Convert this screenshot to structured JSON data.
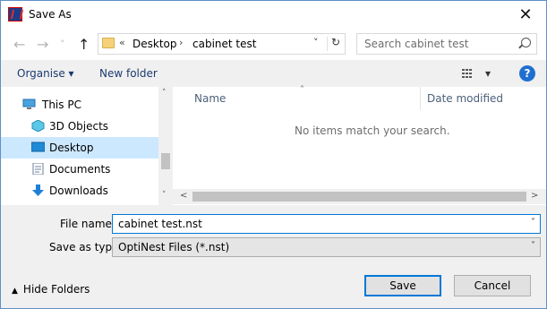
{
  "window": {
    "title": "Save As",
    "close_glyph": "✕",
    "app_icon": "optinest-app-icon"
  },
  "nav": {
    "back_glyph": "←",
    "forward_glyph": "→",
    "recent_glyph": "˅",
    "up_glyph": "↑",
    "breadcrumb": {
      "overflow": "«",
      "items": [
        "Desktop",
        "cabinet test"
      ],
      "separator": "›"
    },
    "dropdown_glyph": "˅",
    "refresh_glyph": "↻",
    "search_placeholder": "Search cabinet test"
  },
  "toolbar": {
    "organise_label": "Organise",
    "organise_caret": "▾",
    "new_folder_label": "New folder",
    "view_caret": "▾",
    "help_glyph": "?"
  },
  "sidebar": {
    "items": [
      {
        "label": "This PC",
        "icon": "pc-icon"
      },
      {
        "label": "3D Objects",
        "icon": "3d-objects-icon"
      },
      {
        "label": "Desktop",
        "icon": "desktop-icon",
        "selected": true
      },
      {
        "label": "Documents",
        "icon": "documents-icon"
      },
      {
        "label": "Downloads",
        "icon": "downloads-icon"
      }
    ],
    "scroll_up_glyph": "˄",
    "scroll_down_glyph": "˅"
  },
  "files": {
    "columns": [
      "Name",
      "Date modified"
    ],
    "sort_glyph": "˄",
    "empty_message": "No items match your search.",
    "scroll_left_glyph": "<",
    "scroll_right_glyph": ">"
  },
  "form": {
    "filename_label": "File name:",
    "filename_value": "cabinet test.nst",
    "type_label": "Save as type:",
    "type_value": "OptiNest Files (*.nst)",
    "dropdown_glyph": "˅"
  },
  "footer": {
    "hide_folders_label": "Hide Folders",
    "hide_caret": "▲",
    "save_label": "Save",
    "cancel_label": "Cancel"
  },
  "colors": {
    "accent": "#0078d7",
    "selected_bg": "#cce8ff",
    "help_blue": "#1f6fd1"
  }
}
